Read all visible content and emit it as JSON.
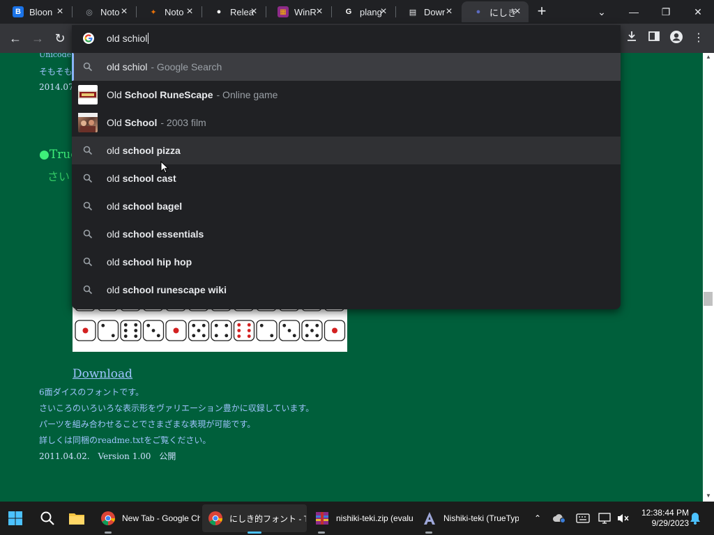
{
  "tabs": [
    {
      "title": "Bloon",
      "icon": "b-logo-icon",
      "color": "#1a73e8",
      "glyph": "B"
    },
    {
      "title": "Noto",
      "icon": "globe-icon",
      "color": "#9aa0a6",
      "glyph": "◎"
    },
    {
      "title": "Noto",
      "icon": "figma-icon",
      "color": "#e8710a",
      "glyph": "✦"
    },
    {
      "title": "Relea",
      "icon": "github-icon",
      "color": "#ffffff",
      "glyph": "●"
    },
    {
      "title": "WinR",
      "icon": "winrar-icon",
      "color": "#8e2b88",
      "glyph": "▦"
    },
    {
      "title": "plang",
      "icon": "google-icon",
      "color": "#ffffff",
      "glyph": "G"
    },
    {
      "title": "Dowr",
      "icon": "document-icon",
      "color": "#e8eaed",
      "glyph": "▤"
    },
    {
      "title": "にしき",
      "icon": "nishiki-icon",
      "color": "#5c6bc0",
      "glyph": "●"
    }
  ],
  "omnibox": {
    "query": "old schiol",
    "suggestions": [
      {
        "parts": [
          {
            "t": "old schiol",
            "b": false
          }
        ],
        "suffix": "- Google Search",
        "type": "search",
        "state": "selected"
      },
      {
        "parts": [
          {
            "t": "Old ",
            "b": false
          },
          {
            "t": "School RuneScape",
            "b": true
          }
        ],
        "suffix": "- Online game",
        "type": "entity-runescape"
      },
      {
        "parts": [
          {
            "t": "Old ",
            "b": false
          },
          {
            "t": "School",
            "b": true
          }
        ],
        "suffix": "- 2003 film",
        "type": "entity-film"
      },
      {
        "parts": [
          {
            "t": "old ",
            "b": false
          },
          {
            "t": "school pizza",
            "b": true
          }
        ],
        "suffix": "",
        "type": "search",
        "state": "hover"
      },
      {
        "parts": [
          {
            "t": "old ",
            "b": false
          },
          {
            "t": "school cast",
            "b": true
          }
        ],
        "suffix": "",
        "type": "search"
      },
      {
        "parts": [
          {
            "t": "old ",
            "b": false
          },
          {
            "t": "school bagel",
            "b": true
          }
        ],
        "suffix": "",
        "type": "search"
      },
      {
        "parts": [
          {
            "t": "old ",
            "b": false
          },
          {
            "t": "school essentials",
            "b": true
          }
        ],
        "suffix": "",
        "type": "search"
      },
      {
        "parts": [
          {
            "t": "old ",
            "b": false
          },
          {
            "t": "school hip hop",
            "b": true
          }
        ],
        "suffix": "",
        "type": "search"
      },
      {
        "parts": [
          {
            "t": "old ",
            "b": false
          },
          {
            "t": "school runescape wiki",
            "b": true
          }
        ],
        "suffix": "",
        "type": "search"
      }
    ]
  },
  "page": {
    "top_line1": "Unicode",
    "top_line2": "そもそも",
    "top_line3": "2014.07.",
    "true_head": "●True",
    "true_sub": "さい",
    "download_link": "Download",
    "desc1": "6面ダイスのフォントです。",
    "desc2": "さいころのいろいろな表示形をヴァリエーション豊かに収録しています。",
    "desc3": "パーツを組み合わせることでさまざまな表現が可能です。",
    "desc4": "詳しくは同梱のreadme.txtをご覧ください。",
    "version_line": "2011.04.02.　Version 1.00　公開"
  },
  "taskbar": {
    "items": [
      {
        "label": "New Tab - Google Ch",
        "icon": "chrome-icon"
      },
      {
        "label": "にしき的フォント - TYPV",
        "icon": "chrome-icon"
      },
      {
        "label": "nishiki-teki.zip (evalu",
        "icon": "winrar-icon"
      },
      {
        "label": "Nishiki-teki (TrueTyp",
        "icon": "font-viewer-icon"
      }
    ],
    "time": "12:38:44 PM",
    "date": "9/29/2023"
  },
  "colors": {
    "page_bg": "#005f3b",
    "link": "#9fc4ff",
    "green_heading": "#3ef07a",
    "dropdown_bg": "#202124"
  }
}
